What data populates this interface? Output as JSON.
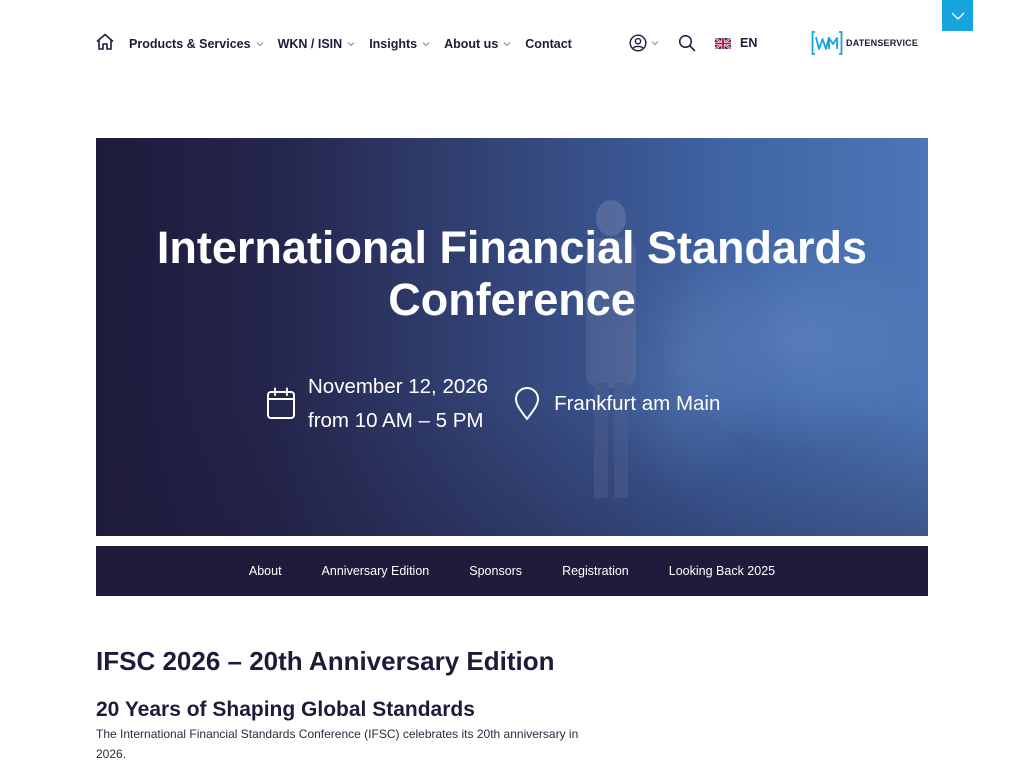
{
  "nav": {
    "items": [
      {
        "label": "Products & Services",
        "has_dropdown": true
      },
      {
        "label": "WKN / ISIN",
        "has_dropdown": true
      },
      {
        "label": "Insights",
        "has_dropdown": true
      },
      {
        "label": "About us",
        "has_dropdown": true
      },
      {
        "label": "Contact",
        "has_dropdown": false
      }
    ],
    "language": "EN",
    "icons": [
      "home-icon",
      "user-icon",
      "search-icon",
      "uk-flag-icon",
      "chevron-down-icon"
    ]
  },
  "logo": {
    "mark": "WM",
    "text": "DATENSERVICE",
    "accent_color": "#17a3dd"
  },
  "hero": {
    "title_line1": "International Financial Standards",
    "title_line2": "Conference",
    "date": "November 12, 2026",
    "time": "from 10 AM – 5 PM",
    "location": "Frankfurt am Main"
  },
  "subnav": {
    "items": [
      "About",
      "Anniversary Edition",
      "Sponsors",
      "Registration",
      "Looking Back 2025"
    ]
  },
  "content": {
    "heading": "IFSC 2026 – 20th Anniversary Edition",
    "subheading": "20 Years of Shaping Global Standards",
    "paragraph": "The International Financial Standards Conference (IFSC) celebrates its 20th anniversary in 2026."
  },
  "colors": {
    "navy": "#1e1b3b",
    "accent": "#17a3dd",
    "hero_blue": "#4d76b6"
  }
}
